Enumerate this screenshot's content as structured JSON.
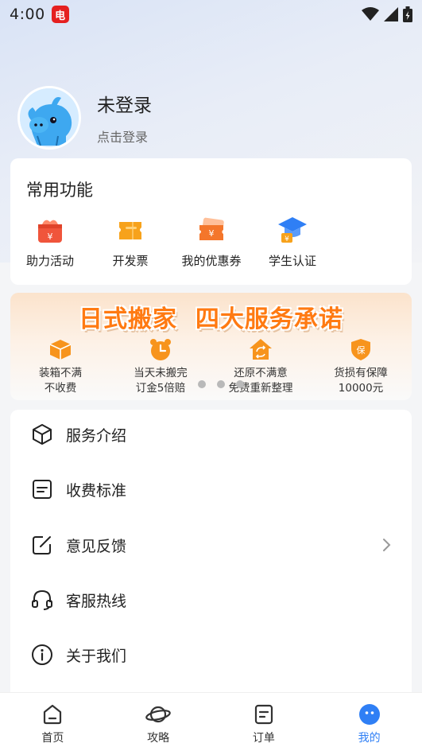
{
  "status_bar": {
    "time": "4:00",
    "app_badge": "电"
  },
  "profile": {
    "name": "未登录",
    "subtitle": "点击登录"
  },
  "functions": {
    "title": "常用功能",
    "items": [
      {
        "label": "助力活动",
        "icon": "gift-box-icon"
      },
      {
        "label": "开发票",
        "icon": "invoice-ticket-icon"
      },
      {
        "label": "我的优惠券",
        "icon": "coupon-icon"
      },
      {
        "label": "学生认证",
        "icon": "graduation-cap-icon"
      }
    ]
  },
  "banner": {
    "title": "日式搬家  四大服务承诺",
    "promises": [
      {
        "line1": "装箱不满",
        "line2": "不收费",
        "icon": "box-icon"
      },
      {
        "line1": "当天未搬完",
        "line2": "订金5倍赔",
        "icon": "clock-icon"
      },
      {
        "line1": "还原不满意",
        "line2": "免费重新整理",
        "icon": "home-refresh-icon"
      },
      {
        "line1": "货损有保障",
        "line2": "10000元",
        "icon": "shield-icon",
        "badge": "保"
      }
    ],
    "page_dots": 3
  },
  "menu": [
    {
      "label": "服务介绍",
      "icon": "cube-icon"
    },
    {
      "label": "收费标准",
      "icon": "price-doc-icon"
    },
    {
      "label": "意见反馈",
      "icon": "edit-feedback-icon"
    },
    {
      "label": "客服热线",
      "icon": "headset-icon"
    },
    {
      "label": "关于我们",
      "icon": "info-icon"
    }
  ],
  "tabbar": {
    "active": "我的",
    "items": [
      {
        "label": "首页",
        "icon": "home-icon"
      },
      {
        "label": "攻略",
        "icon": "planet-icon"
      },
      {
        "label": "订单",
        "icon": "order-icon"
      },
      {
        "label": "我的",
        "icon": "profile-face-icon"
      }
    ]
  },
  "colors": {
    "accent": "#2f7ff5",
    "banner_orange": "#ff7a12",
    "icon_red": "#f0553b",
    "icon_orange": "#f7a21b"
  }
}
